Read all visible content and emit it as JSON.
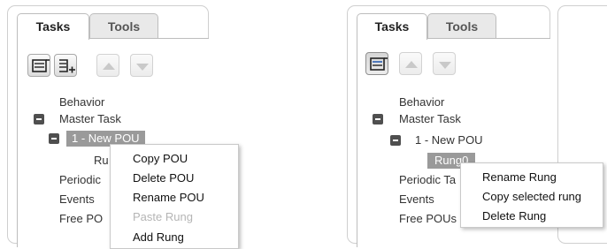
{
  "left": {
    "tabs": [
      {
        "label": "Tasks",
        "active": true
      },
      {
        "label": "Tools",
        "active": false
      }
    ],
    "toolbar": [
      {
        "icon": "collapse-all-icon",
        "state": "enabled"
      },
      {
        "icon": "expand-add-icon",
        "state": "enabled"
      },
      {
        "icon": "move-up-icon",
        "state": "disabled"
      },
      {
        "icon": "move-down-icon",
        "state": "disabled"
      }
    ],
    "tree": {
      "behavior": "Behavior",
      "master_task": "Master Task",
      "pou": "1 - New POU",
      "rung_partial": "Ru",
      "periodic_partial": "Periodic",
      "events": "Events",
      "free_partial": "Free PO"
    },
    "context_menu": [
      {
        "label": "Copy POU",
        "enabled": true
      },
      {
        "label": "Delete POU",
        "enabled": true
      },
      {
        "label": "Rename POU",
        "enabled": true
      },
      {
        "label": "Paste Rung",
        "enabled": false
      },
      {
        "label": "Add Rung",
        "enabled": true
      }
    ]
  },
  "right": {
    "tabs": [
      {
        "label": "Tasks",
        "active": true
      },
      {
        "label": "Tools",
        "active": false
      }
    ],
    "toolbar": [
      {
        "icon": "collapse-all-icon",
        "state": "pressed"
      },
      {
        "icon": "move-up-icon",
        "state": "disabled"
      },
      {
        "icon": "move-down-icon",
        "state": "disabled"
      }
    ],
    "tree": {
      "behavior": "Behavior",
      "master_task": "Master Task",
      "pou": "1 - New POU",
      "rung": "Rung0",
      "periodic_partial": "Periodic Ta",
      "events": "Events",
      "free_partial": "Free POUs"
    },
    "context_menu": [
      {
        "label": "Rename Rung",
        "enabled": true
      },
      {
        "label": "Copy selected rung",
        "enabled": true
      },
      {
        "label": "Delete Rung",
        "enabled": true
      }
    ]
  },
  "colors": {
    "selection": "#9a9a9a",
    "tree_toggle": "#4f4f4f",
    "disabled_text": "#b5b5b5"
  }
}
